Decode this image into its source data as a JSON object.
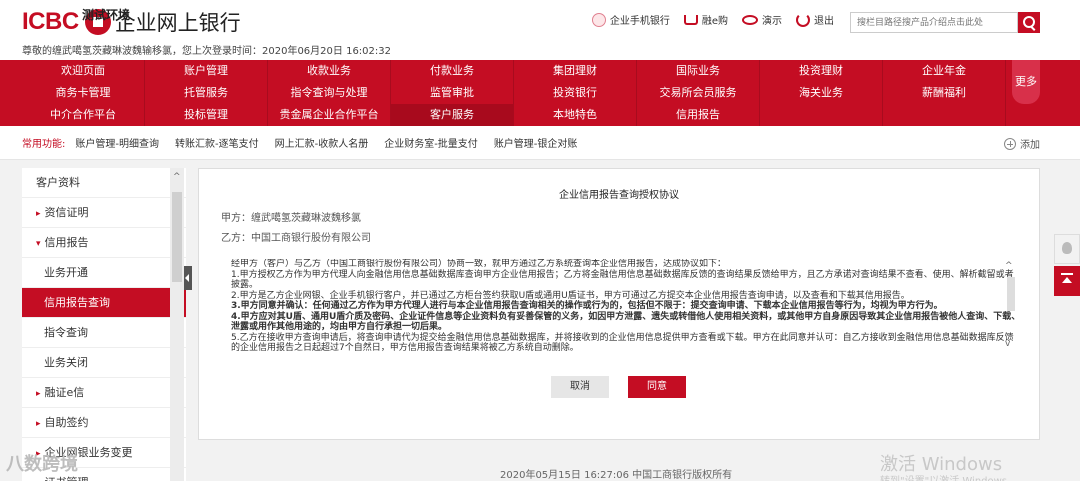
{
  "header": {
    "brand": "ICBC",
    "title": "企业网上银行",
    "env_label": "测试环境",
    "welcome": "尊敬的缠武噶氢茨藏琳波魏输移氯，您上次登录时间：2020年06月20日 16:02:32",
    "links": [
      {
        "label": "企业手机银行",
        "icon": "mobile-icon"
      },
      {
        "label": "融e购",
        "icon": "cart-icon"
      },
      {
        "label": "演示",
        "icon": "eye-icon"
      },
      {
        "label": "退出",
        "icon": "power-icon"
      }
    ],
    "search_placeholder": "搜栏目路径搜产品介绍点击此处"
  },
  "nav": {
    "items": [
      "欢迎页面",
      "账户管理",
      "收款业务",
      "付款业务",
      "集团理财",
      "国际业务",
      "投资理财",
      "企业年金",
      "商务卡管理",
      "托管服务",
      "指令查询与处理",
      "监管审批",
      "投资银行",
      "交易所会员服务",
      "海关业务",
      "薪酬福利",
      "中介合作平台",
      "投标管理",
      "贵金属企业合作平台",
      "客户服务",
      "本地特色",
      "信用报告",
      "",
      ""
    ],
    "active_index": 19,
    "more": "更多"
  },
  "quick": {
    "label": "常用功能:",
    "links": [
      "账户管理-明细查询",
      "转账汇款-逐笔支付",
      "网上汇款-收款人名册",
      "企业财务室-批量支付",
      "账户管理-银企对账"
    ],
    "add": "添加"
  },
  "sidebar": {
    "items": [
      {
        "label": "客户资料",
        "type": "top"
      },
      {
        "label": "资信证明",
        "type": "arrow"
      },
      {
        "label": "信用报告",
        "type": "open"
      },
      {
        "label": "业务开通",
        "type": "sub"
      },
      {
        "label": "信用报告查询",
        "type": "sub-active"
      },
      {
        "label": "指令查询",
        "type": "sub"
      },
      {
        "label": "业务关闭",
        "type": "sub"
      },
      {
        "label": "融证e信",
        "type": "arrow"
      },
      {
        "label": "自助签约",
        "type": "arrow"
      },
      {
        "label": "企业网银业务变更",
        "type": "arrow"
      },
      {
        "label": "证书管理",
        "type": "arrow"
      }
    ]
  },
  "agreement": {
    "title": "企业信用报告查询授权协议",
    "party_a": "甲方：缠武噶氢茨藏琳波魏移氯",
    "party_b": "乙方：中国工商银行股份有限公司",
    "paragraphs": [
      {
        "text": "经甲方（客户）与乙方（中国工商银行股份有限公司）协商一致，就甲方通过乙方系统查询本企业信用报告，达成协议如下：",
        "bold": false
      },
      {
        "text": "1.甲方授权乙方作为甲方代理人向金融信用信息基础数据库查询甲方企业信用报告；乙方将金融信用信息基础数据库反馈的查询结果反馈给甲方，且乙方承诺对查询结果不查看、使用、解析截留或者披露。",
        "bold": false
      },
      {
        "text": "2.甲方是乙方企业网银、企业手机银行客户，并已通过乙方柜台签约获取U盾或通用U盾证书，甲方可通过乙方提交本企业信用报告查询申请，以及查看和下载其信用报告。",
        "bold": false
      },
      {
        "text": "3.甲方同意并确认：任何通过乙方作为甲方代理人进行与本企业信用报告查询相关的操作或行为的，包括但不限于：提交查询申请、下载本企业信用报告等行为，均视为甲方行为。",
        "bold": true
      },
      {
        "text": "4.甲方应对其U盾、通用U盾介质及密码、企业证件信息等企业资料负有妥善保管的义务，如因甲方泄露、遗失或转借他人使用相关资料，或其他甲方自身原因导致其企业信用报告被他人查询、下载、泄露或用作其他用途的，均由甲方自行承担一切后果。",
        "bold": true
      },
      {
        "text": "5.乙方在接收甲方查询申请后，将查询申请代为提交给金融信用信息基础数据库，并将接收到的企业信用信息提供甲方查看或下载。甲方在此同意并认可：自乙方接收到金融信用信息基础数据库反馈的企业信用报告之日起超过7个自然日，甲方信用报告查询结果将被乙方系统自动删除。",
        "bold": false
      }
    ],
    "cancel": "取消",
    "agree": "同意"
  },
  "footer": "2020年05月15日 16:27:06   中国工商银行版权所有",
  "watermarks": {
    "windows_title": "激活 Windows",
    "windows_sub": "转到\"设置\"以激活 Windows。",
    "left": "八数跨境"
  },
  "colors": {
    "brand_red": "#c40d23",
    "nav_active": "#a80a1d",
    "bg_grey": "#f2f2f2"
  }
}
